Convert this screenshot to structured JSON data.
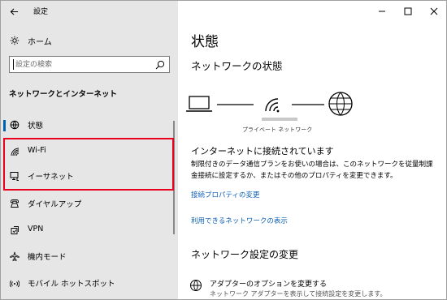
{
  "window": {
    "title": "設定"
  },
  "sidebar": {
    "home_label": "ホーム",
    "search_placeholder": "設定の検索",
    "section_title": "ネットワークとインターネット",
    "items": [
      {
        "label": "状態",
        "icon": "globe-status-icon",
        "selected": true
      },
      {
        "label": "Wi-Fi",
        "icon": "wifi-icon"
      },
      {
        "label": "イーサネット",
        "icon": "ethernet-icon"
      },
      {
        "label": "ダイヤルアップ",
        "icon": "phone-icon"
      },
      {
        "label": "VPN",
        "icon": "vpn-icon"
      },
      {
        "label": "機内モード",
        "icon": "airplane-icon"
      },
      {
        "label": "モバイル ホットスポット",
        "icon": "hotspot-icon"
      }
    ]
  },
  "main": {
    "title": "状態",
    "network_status_heading": "ネットワークの状態",
    "network_profile": "プライベート ネットワーク",
    "connection_status": "インターネットに接続されています",
    "description": "制限付きのデータ通信プランをお使いの場合は、このネットワークを従量制課金接続に設定するか、またはその他のプロパティを変更できます。",
    "link_connection_properties": "接続プロパティの変更",
    "link_available_networks": "利用できるネットワークの表示",
    "settings_change_heading": "ネットワーク設定の変更",
    "adapter_options_title": "アダプターのオプションを変更する",
    "adapter_options_sub": "ネットワーク アダプターを表示して接続設定を変更します。"
  },
  "colors": {
    "accent": "#0063b1",
    "link": "#0a5eb5",
    "highlight_border": "#e8001c",
    "sidebar_bg": "#e6e6e6"
  }
}
